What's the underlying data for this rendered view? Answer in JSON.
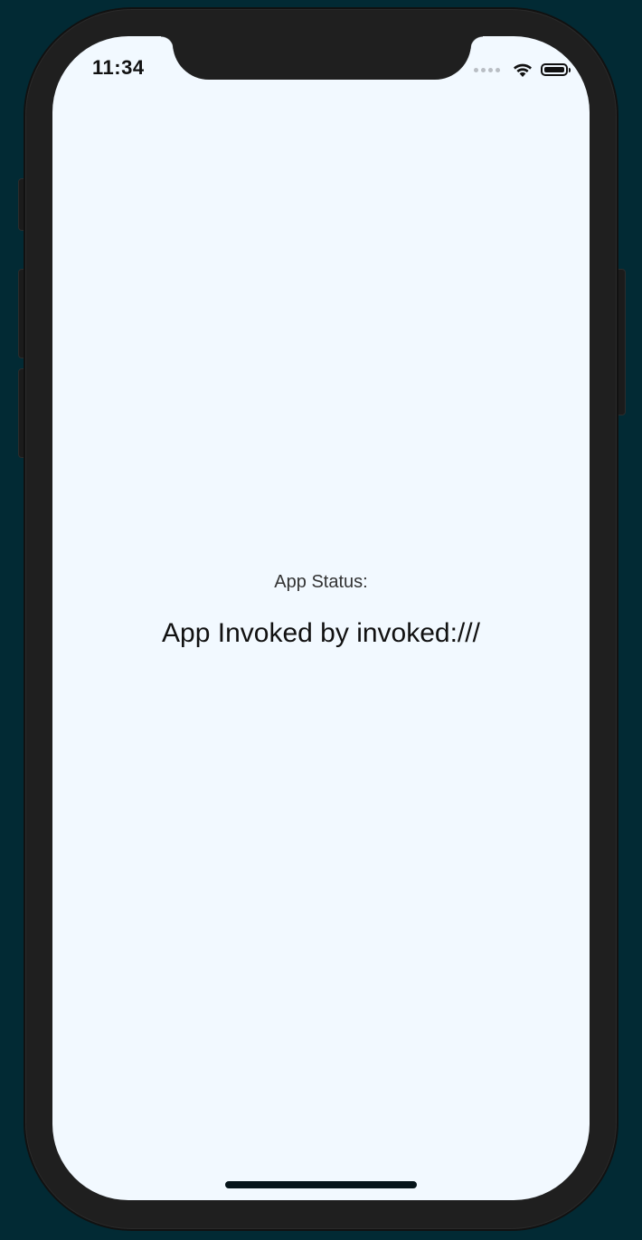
{
  "status_bar": {
    "time": "11:34",
    "icons": [
      "cellular-signal-icon",
      "wifi-icon",
      "battery-icon"
    ]
  },
  "main": {
    "status_label": "App Status:",
    "status_message": "App Invoked by invoked:///"
  },
  "colors": {
    "background": "#022a34",
    "screen": "#f2f9ff",
    "device_frame": "#1f1f1f",
    "text": "#111111"
  }
}
